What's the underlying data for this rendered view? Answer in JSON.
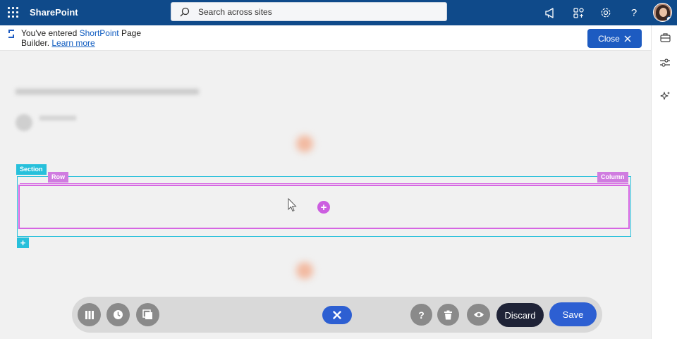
{
  "suitebar": {
    "app_name": "SharePoint",
    "search_placeholder": "Search across sites",
    "icons": [
      "waffle-icon",
      "megaphone-icon",
      "apps-icon",
      "settings-icon",
      "help-icon"
    ],
    "background": "#0f4a8a"
  },
  "notice": {
    "prefix": "You've entered ",
    "brand": "ShortPoint",
    "suffix": " Page Builder. ",
    "link": "Learn more",
    "close_label": "Close"
  },
  "rail": {
    "icons": [
      "briefcase-icon",
      "sliders-icon",
      "sparkle-icon"
    ]
  },
  "editor": {
    "section_label": "Section",
    "row_label": "Row",
    "column_label": "Column",
    "add_element_symbol": "+",
    "add_section_symbol": "+",
    "section_color": "#27c0db",
    "column_color": "#d666e3"
  },
  "toolbar": {
    "discard_label": "Discard",
    "save_label": "Save",
    "icons": [
      "columns-icon",
      "history-icon",
      "layers-icon",
      "close-icon",
      "help-icon",
      "trash-icon",
      "preview-eye-icon"
    ],
    "accent": "#2d5fd2"
  }
}
